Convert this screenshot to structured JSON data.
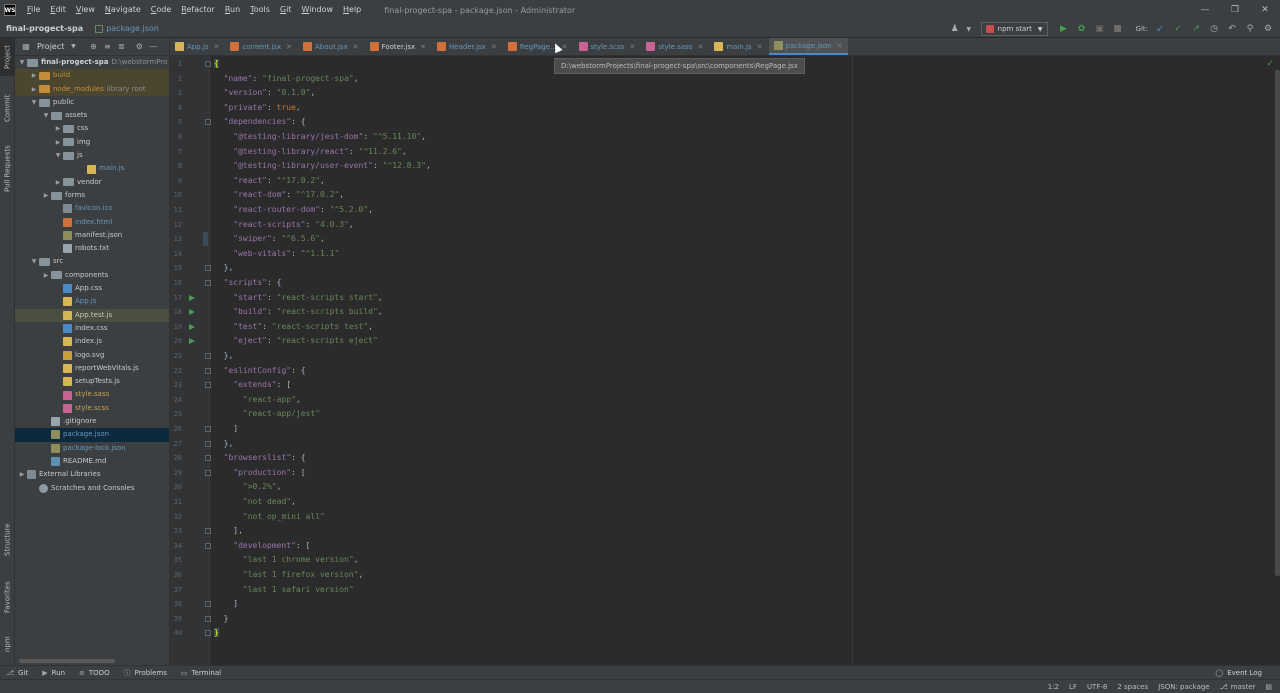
{
  "titlebar": {
    "logo": "WS",
    "menu": [
      "File",
      "Edit",
      "View",
      "Navigate",
      "Code",
      "Refactor",
      "Run",
      "Tools",
      "Git",
      "Window",
      "Help"
    ],
    "title": "final-progect-spa - package.json - Administrator"
  },
  "navbar": {
    "project": "final-progect-spa",
    "file": "package.json",
    "run_config": "npm start",
    "git_label": "Git:"
  },
  "stripe": {
    "left_top": [
      "Project",
      "Commit",
      "Pull Requests"
    ],
    "left_bottom": [
      "Structure",
      "Favorites",
      "npm"
    ]
  },
  "project_panel": {
    "title": "Project",
    "tree": [
      {
        "label": "final-progect-spa",
        "suffix": "D:\\webstormPro",
        "depth": 0,
        "arrow": "down",
        "icon": "folder",
        "style": "bold"
      },
      {
        "label": "build",
        "depth": 1,
        "arrow": "right",
        "icon": "folder-orange",
        "style": "orange",
        "row": "excluded"
      },
      {
        "label": "node_modules",
        "suffix": "library root",
        "depth": 1,
        "arrow": "right",
        "icon": "folder-orange",
        "style": "orange",
        "row": "excluded"
      },
      {
        "label": "public",
        "depth": 1,
        "arrow": "down",
        "icon": "folder"
      },
      {
        "label": "assets",
        "depth": 2,
        "arrow": "down",
        "icon": "folder"
      },
      {
        "label": "css",
        "depth": 3,
        "arrow": "right",
        "icon": "folder"
      },
      {
        "label": "img",
        "depth": 3,
        "arrow": "right",
        "icon": "folder"
      },
      {
        "label": "js",
        "depth": 3,
        "arrow": "down",
        "icon": "folder"
      },
      {
        "label": "main.js",
        "depth": 5,
        "icon": "js",
        "style": "blue"
      },
      {
        "label": "vendor",
        "depth": 3,
        "arrow": "right",
        "icon": "folder"
      },
      {
        "label": "forms",
        "depth": 2,
        "arrow": "right",
        "icon": "folder"
      },
      {
        "label": "favicon.ico",
        "depth": 3,
        "icon": "ico",
        "style": "blue"
      },
      {
        "label": "index.html",
        "depth": 3,
        "icon": "html",
        "style": "blue"
      },
      {
        "label": "manifest.json",
        "depth": 3,
        "icon": "json"
      },
      {
        "label": "robots.txt",
        "depth": 3,
        "icon": "txt"
      },
      {
        "label": "src",
        "depth": 1,
        "arrow": "down",
        "icon": "folder"
      },
      {
        "label": "components",
        "depth": 2,
        "arrow": "right",
        "icon": "folder"
      },
      {
        "label": "App.css",
        "depth": 3,
        "icon": "css"
      },
      {
        "label": "App.js",
        "depth": 3,
        "icon": "js",
        "style": "blue"
      },
      {
        "label": "App.test.js",
        "depth": 3,
        "icon": "js",
        "row": "modified-hl"
      },
      {
        "label": "index.css",
        "depth": 3,
        "icon": "css"
      },
      {
        "label": "index.js",
        "depth": 3,
        "icon": "js"
      },
      {
        "label": "logo.svg",
        "depth": 3,
        "icon": "svg"
      },
      {
        "label": "reportWebVitals.js",
        "depth": 3,
        "icon": "js"
      },
      {
        "label": "setupTests.js",
        "depth": 3,
        "icon": "js"
      },
      {
        "label": "style.sass",
        "depth": 3,
        "icon": "sass",
        "style": "gold"
      },
      {
        "label": "style.scss",
        "depth": 3,
        "icon": "sass",
        "style": "gold"
      },
      {
        "label": ".gitignore",
        "depth": 2,
        "icon": "txt"
      },
      {
        "label": "package.json",
        "depth": 2,
        "icon": "json",
        "style": "blue",
        "row": "selected"
      },
      {
        "label": "package-lock.json",
        "depth": 2,
        "icon": "json",
        "style": "blue"
      },
      {
        "label": "README.md",
        "depth": 2,
        "icon": "md"
      },
      {
        "label": "External Libraries",
        "depth": 0,
        "arrow": "right",
        "icon": "lib"
      },
      {
        "label": "Scratches and Consoles",
        "depth": 1,
        "icon": "scratch"
      }
    ]
  },
  "tabs": [
    {
      "label": "App.js",
      "icon": "js",
      "style": "blue"
    },
    {
      "label": "content.jsx",
      "icon": "jsx",
      "style": "blue"
    },
    {
      "label": "About.jsx",
      "icon": "jsx",
      "style": "blue"
    },
    {
      "label": "Footer.jsx",
      "icon": "jsx",
      "style": "normal"
    },
    {
      "label": "Header.jsx",
      "icon": "jsx",
      "style": "blue"
    },
    {
      "label": "RegPage...",
      "icon": "jsx",
      "style": "blue"
    },
    {
      "label": "style.scss",
      "icon": "sass",
      "style": "blue"
    },
    {
      "label": "style.sass",
      "icon": "sass",
      "style": "blue"
    },
    {
      "label": "main.js",
      "icon": "js",
      "style": "blue"
    },
    {
      "label": "package.json",
      "icon": "json",
      "style": "blue",
      "active": true
    }
  ],
  "tooltip": "D:\\webstormProjects\\final-progect-spa\\src\\components\\RegPage.jsx",
  "editor": {
    "lines": [
      [
        [
          "p",
          "{"
        ]
      ],
      [
        [
          "p",
          "  "
        ],
        [
          "k",
          "\"name\""
        ],
        [
          "p",
          ": "
        ],
        [
          "s",
          "\"final-progect-spa\""
        ],
        [
          "p",
          ","
        ]
      ],
      [
        [
          "p",
          "  "
        ],
        [
          "k",
          "\"version\""
        ],
        [
          "p",
          ": "
        ],
        [
          "s",
          "\"0.1.0\""
        ],
        [
          "p",
          ","
        ]
      ],
      [
        [
          "p",
          "  "
        ],
        [
          "k",
          "\"private\""
        ],
        [
          "p",
          ": "
        ],
        [
          "kw",
          "true"
        ],
        [
          "p",
          ","
        ]
      ],
      [
        [
          "p",
          "  "
        ],
        [
          "k",
          "\"dependencies\""
        ],
        [
          "p",
          ": {"
        ]
      ],
      [
        [
          "p",
          "    "
        ],
        [
          "k",
          "\"@testing-library/jest-dom\""
        ],
        [
          "p",
          ": "
        ],
        [
          "s",
          "\"^5.11.10\""
        ],
        [
          "p",
          ","
        ]
      ],
      [
        [
          "p",
          "    "
        ],
        [
          "k",
          "\"@testing-library/react\""
        ],
        [
          "p",
          ": "
        ],
        [
          "s",
          "\"^11.2.6\""
        ],
        [
          "p",
          ","
        ]
      ],
      [
        [
          "p",
          "    "
        ],
        [
          "k",
          "\"@testing-library/user-event\""
        ],
        [
          "p",
          ": "
        ],
        [
          "s",
          "\"^12.8.3\""
        ],
        [
          "p",
          ","
        ]
      ],
      [
        [
          "p",
          "    "
        ],
        [
          "k",
          "\"react\""
        ],
        [
          "p",
          ": "
        ],
        [
          "s",
          "\"^17.0.2\""
        ],
        [
          "p",
          ","
        ]
      ],
      [
        [
          "p",
          "    "
        ],
        [
          "k",
          "\"react-dom\""
        ],
        [
          "p",
          ": "
        ],
        [
          "s",
          "\"^17.0.2\""
        ],
        [
          "p",
          ","
        ]
      ],
      [
        [
          "p",
          "    "
        ],
        [
          "k",
          "\"react-router-dom\""
        ],
        [
          "p",
          ": "
        ],
        [
          "s",
          "\"^5.2.0\""
        ],
        [
          "p",
          ","
        ]
      ],
      [
        [
          "p",
          "    "
        ],
        [
          "k",
          "\"react-scripts\""
        ],
        [
          "p",
          ": "
        ],
        [
          "s",
          "\"4.0.3\""
        ],
        [
          "p",
          ","
        ]
      ],
      [
        [
          "p",
          "    "
        ],
        [
          "k",
          "\"swiper\""
        ],
        [
          "p",
          ": "
        ],
        [
          "s",
          "\"^6.5.6\""
        ],
        [
          "p",
          ","
        ]
      ],
      [
        [
          "p",
          "    "
        ],
        [
          "k",
          "\"web-vitals\""
        ],
        [
          "p",
          ": "
        ],
        [
          "s",
          "\"^1.1.1\""
        ]
      ],
      [
        [
          "p",
          "  },"
        ]
      ],
      [
        [
          "p",
          "  "
        ],
        [
          "k",
          "\"scripts\""
        ],
        [
          "p",
          ": {"
        ]
      ],
      [
        [
          "p",
          "    "
        ],
        [
          "k",
          "\"start\""
        ],
        [
          "p",
          ": "
        ],
        [
          "s",
          "\"react-scripts start\""
        ],
        [
          "p",
          ","
        ]
      ],
      [
        [
          "p",
          "    "
        ],
        [
          "k",
          "\"build\""
        ],
        [
          "p",
          ": "
        ],
        [
          "s",
          "\"react-scripts build\""
        ],
        [
          "p",
          ","
        ]
      ],
      [
        [
          "p",
          "    "
        ],
        [
          "k",
          "\"test\""
        ],
        [
          "p",
          ": "
        ],
        [
          "s",
          "\"react-scripts test\""
        ],
        [
          "p",
          ","
        ]
      ],
      [
        [
          "p",
          "    "
        ],
        [
          "k",
          "\"eject\""
        ],
        [
          "p",
          ": "
        ],
        [
          "s",
          "\"react-scripts eject\""
        ]
      ],
      [
        [
          "p",
          "  },"
        ]
      ],
      [
        [
          "p",
          "  "
        ],
        [
          "k",
          "\"eslintConfig\""
        ],
        [
          "p",
          ": {"
        ]
      ],
      [
        [
          "p",
          "    "
        ],
        [
          "k",
          "\"extends\""
        ],
        [
          "p",
          ": ["
        ]
      ],
      [
        [
          "p",
          "      "
        ],
        [
          "s",
          "\"react-app\""
        ],
        [
          "p",
          ","
        ]
      ],
      [
        [
          "p",
          "      "
        ],
        [
          "s",
          "\"react-app/jest\""
        ]
      ],
      [
        [
          "p",
          "    ]"
        ]
      ],
      [
        [
          "p",
          "  },"
        ]
      ],
      [
        [
          "p",
          "  "
        ],
        [
          "k",
          "\"browserslist\""
        ],
        [
          "p",
          ": {"
        ]
      ],
      [
        [
          "p",
          "    "
        ],
        [
          "k",
          "\"production\""
        ],
        [
          "p",
          ": ["
        ]
      ],
      [
        [
          "p",
          "      "
        ],
        [
          "s",
          "\">0.2%\""
        ],
        [
          "p",
          ","
        ]
      ],
      [
        [
          "p",
          "      "
        ],
        [
          "s",
          "\"not dead\""
        ],
        [
          "p",
          ","
        ]
      ],
      [
        [
          "p",
          "      "
        ],
        [
          "s",
          "\"not op_mini all\""
        ]
      ],
      [
        [
          "p",
          "    ],"
        ]
      ],
      [
        [
          "p",
          "    "
        ],
        [
          "k",
          "\"development\""
        ],
        [
          "p",
          ": ["
        ]
      ],
      [
        [
          "p",
          "      "
        ],
        [
          "s",
          "\"last 1 chrome version\""
        ],
        [
          "p",
          ","
        ]
      ],
      [
        [
          "p",
          "      "
        ],
        [
          "s",
          "\"last 1 firefox version\""
        ],
        [
          "p",
          ","
        ]
      ],
      [
        [
          "p",
          "      "
        ],
        [
          "s",
          "\"last 1 safari version\""
        ]
      ],
      [
        [
          "p",
          "    ]"
        ]
      ],
      [
        [
          "p",
          "  }"
        ]
      ],
      [
        [
          "p",
          "}"
        ]
      ]
    ],
    "run_lines": [
      17,
      18,
      19,
      20
    ],
    "fold_lines": [
      1,
      5,
      15,
      16,
      21,
      22,
      23,
      26,
      27,
      28,
      29,
      33,
      34,
      38,
      39,
      40
    ]
  },
  "toolwindows": {
    "items": [
      "Git",
      "Run",
      "TODO",
      "Problems",
      "Terminal"
    ],
    "event_log": "Event Log"
  },
  "statusbar": {
    "position": "1:2",
    "line_sep": "LF",
    "encoding": "UTF-8",
    "indent": "2 spaces",
    "schema": "JSON: package",
    "branch": "master"
  },
  "colors": {
    "accent": "#4a88c7",
    "run": "#499c54",
    "string": "#6a8759",
    "key": "#9876aa",
    "keyword": "#cc7832"
  }
}
